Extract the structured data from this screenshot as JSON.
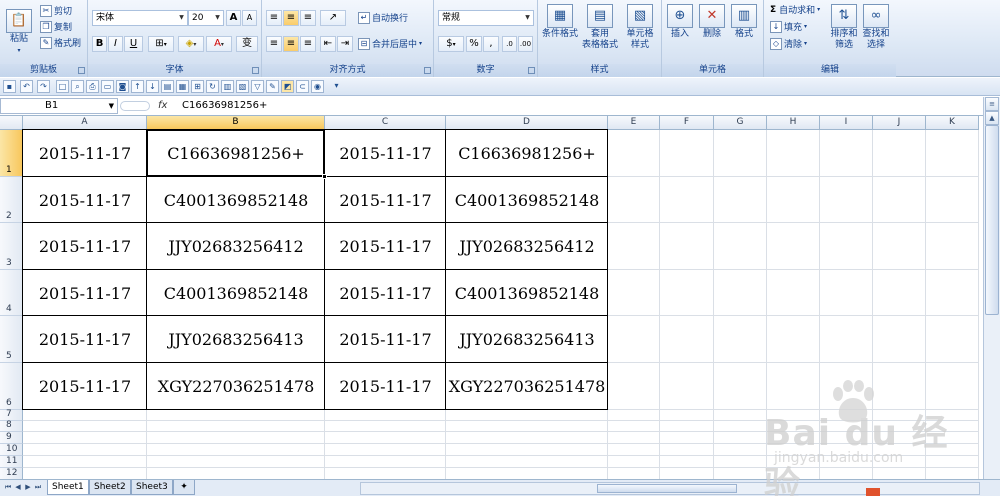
{
  "ribbon": {
    "clipboard": {
      "paste": "粘贴",
      "cut": "剪切",
      "copy": "复制",
      "format_painter": "格式刷",
      "label": "剪贴板"
    },
    "font": {
      "name": "宋体",
      "size": "20",
      "bold": "B",
      "italic": "I",
      "underline": "U",
      "label": "字体"
    },
    "alignment": {
      "wrap": "自动换行",
      "merge": "合并后居中",
      "label": "对齐方式"
    },
    "number": {
      "format": "常规",
      "percent": "%",
      "comma": ",",
      "label": "数字"
    },
    "styles": {
      "conditional": "条件格式",
      "table_line1": "套用",
      "table_line2": "表格格式",
      "cell_line1": "单元格",
      "cell_line2": "样式",
      "label": "样式"
    },
    "cells": {
      "insert": "插入",
      "delete": "删除",
      "format": "格式",
      "label": "单元格"
    },
    "editing": {
      "autosum": "自动求和",
      "fill": "填充",
      "clear": "清除",
      "sort_line1": "排序和",
      "sort_line2": "筛选",
      "find_line1": "查找和",
      "find_line2": "选择",
      "label": "编辑"
    }
  },
  "formula_bar": {
    "name_box": "B1",
    "fx": "fx",
    "content": "C16636981256+"
  },
  "columns": [
    "A",
    "B",
    "C",
    "D",
    "E",
    "F",
    "G",
    "H",
    "I",
    "J",
    "K"
  ],
  "selected_column": "B",
  "selected_row": "1",
  "row_numbers": [
    "1",
    "2",
    "3",
    "4",
    "5",
    "6",
    "7",
    "8",
    "9",
    "10",
    "11",
    "12"
  ],
  "rows": [
    [
      "2015-11-17",
      "C16636981256+",
      "2015-11-17",
      "C16636981256+"
    ],
    [
      "2015-11-17",
      "C4001369852148",
      "2015-11-17",
      "C4001369852148"
    ],
    [
      "2015-11-17",
      "JJY02683256412",
      "2015-11-17",
      "JJY02683256412"
    ],
    [
      "2015-11-17",
      "C4001369852148",
      "2015-11-17",
      "C4001369852148"
    ],
    [
      "2015-11-17",
      "JJY02683256413",
      "2015-11-17",
      "JJY02683256413"
    ],
    [
      "2015-11-17",
      "XGY227036251478",
      "2015-11-17",
      "XGY227036251478"
    ]
  ],
  "sheets": [
    "Sheet1",
    "Sheet2",
    "Sheet3"
  ],
  "active_sheet": "Sheet1",
  "watermark": {
    "brand": "Bai du 经验",
    "url": "jingyan.baidu.com"
  }
}
